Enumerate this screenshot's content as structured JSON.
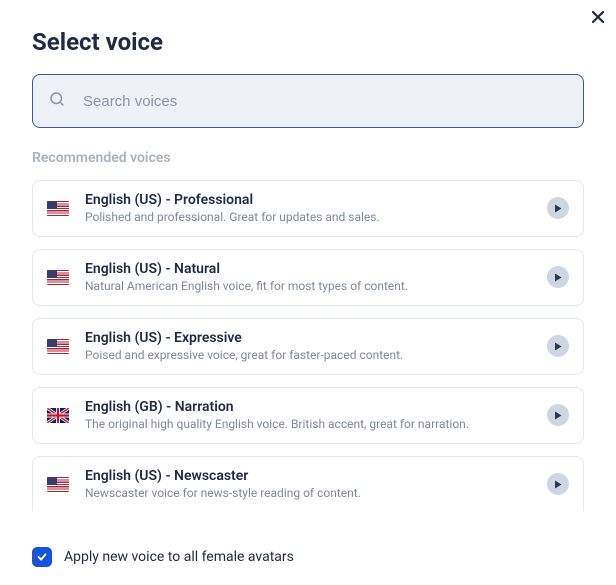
{
  "title": "Select voice",
  "search": {
    "placeholder": "Search voices",
    "value": ""
  },
  "section_label": "Recommended voices",
  "voices": [
    {
      "flag": "us",
      "name": "English (US) - Professional",
      "desc": "Polished and professional. Great for updates and sales."
    },
    {
      "flag": "us",
      "name": "English (US) - Natural",
      "desc": "Natural American English voice, fit for most types of content."
    },
    {
      "flag": "us",
      "name": "English (US) - Expressive",
      "desc": "Poised and expressive voice, great for faster-paced content."
    },
    {
      "flag": "gb",
      "name": "English (GB) - Narration",
      "desc": "The original high quality English voice. British accent, great for narration."
    },
    {
      "flag": "us",
      "name": "English (US) - Newscaster",
      "desc": "Newscaster voice for news-style reading of content."
    }
  ],
  "apply_all": {
    "checked": true,
    "label": "Apply new voice to all female avatars"
  },
  "colors": {
    "accent": "#1853db"
  }
}
